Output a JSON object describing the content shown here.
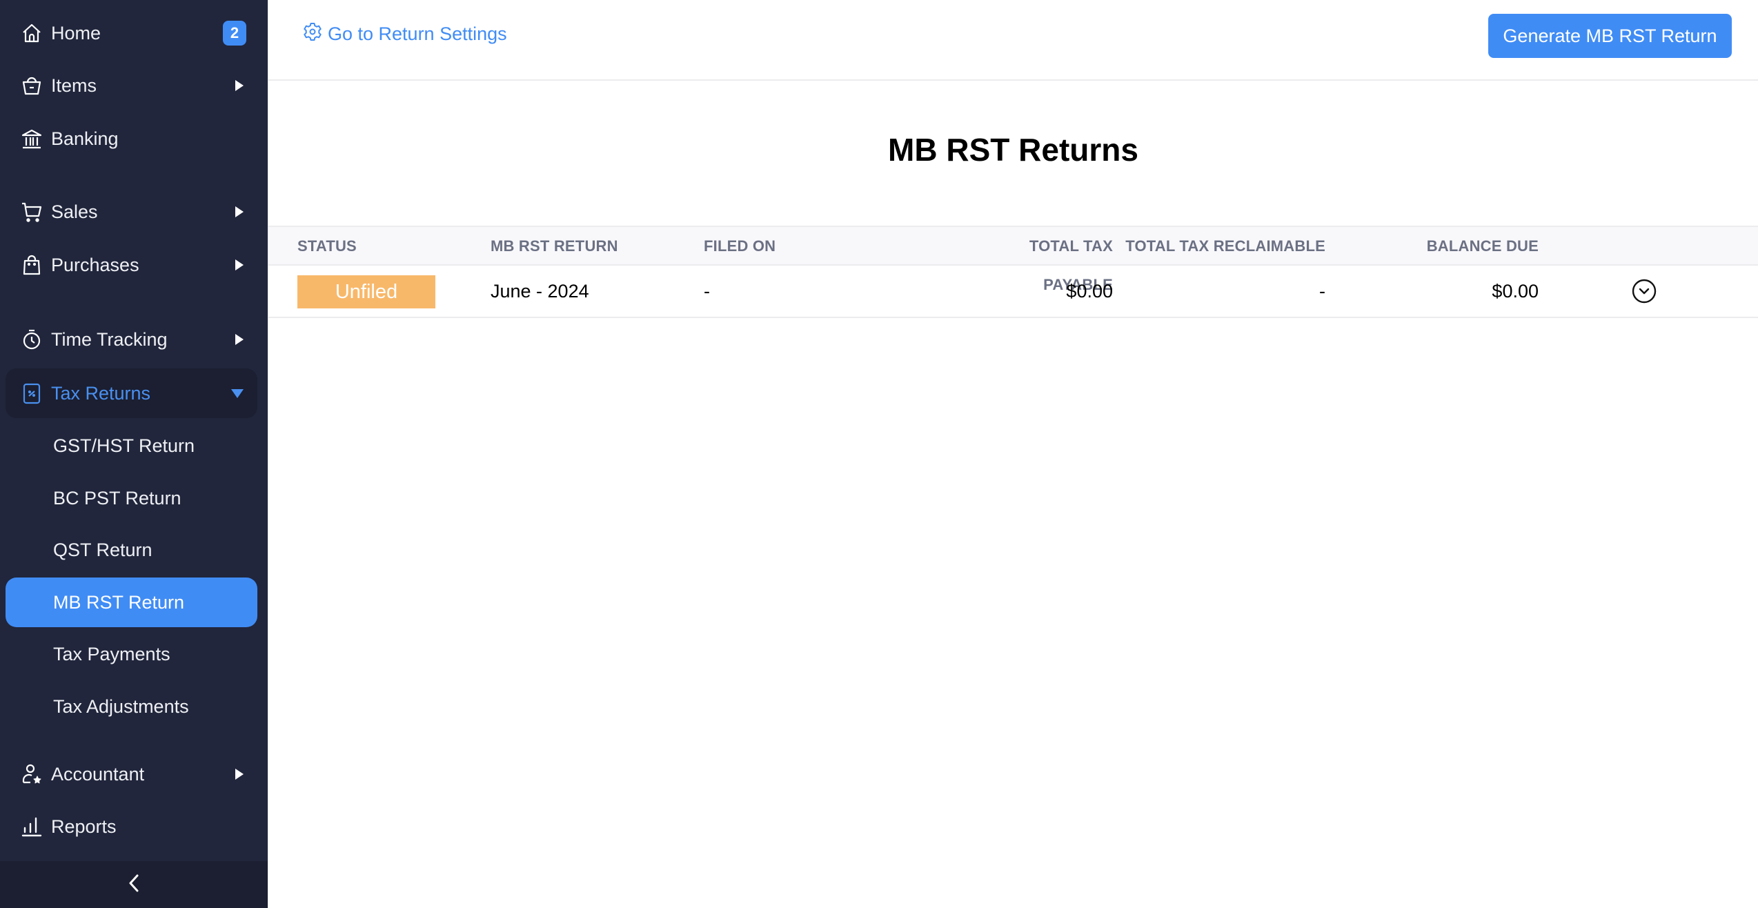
{
  "sidebar": {
    "items": [
      {
        "label": "Home",
        "icon": "home-icon",
        "badge": "2"
      },
      {
        "label": "Items",
        "icon": "basket-icon"
      },
      {
        "label": "Banking",
        "icon": "bank-icon"
      },
      {
        "label": "Sales",
        "icon": "cart-icon"
      },
      {
        "label": "Purchases",
        "icon": "shopping-bag-icon"
      },
      {
        "label": "Time Tracking",
        "icon": "stopwatch-icon"
      },
      {
        "label": "Tax Returns",
        "icon": "tax-percent-icon"
      },
      {
        "label": "Accountant",
        "icon": "accountant-icon"
      },
      {
        "label": "Reports",
        "icon": "bar-chart-icon"
      }
    ],
    "tax_sub_items": [
      {
        "label": "GST/HST Return"
      },
      {
        "label": "BC PST Return"
      },
      {
        "label": "QST Return"
      },
      {
        "label": "MB RST Return",
        "active": true
      },
      {
        "label": "Tax Payments"
      },
      {
        "label": "Tax Adjustments"
      }
    ],
    "collapse_icon": "chevron-left-icon"
  },
  "topbar": {
    "settings_link": "Go to Return Settings",
    "generate_button": "Generate MB RST Return"
  },
  "page": {
    "title": "MB RST Returns"
  },
  "table": {
    "headers": {
      "status": "STATUS",
      "return": "MB RST RETURN",
      "filed_on": "FILED ON",
      "total_tax_payable": "TOTAL TAX PAYABLE",
      "total_tax_reclaimable": "TOTAL TAX RECLAIMABLE",
      "balance_due": "BALANCE DUE"
    },
    "rows": [
      {
        "status": "Unfiled",
        "return": "June - 2024",
        "filed_on": "-",
        "total_tax_payable": "$0.00",
        "total_tax_reclaimable": "-",
        "balance_due": "$0.00"
      }
    ]
  },
  "colors": {
    "accent": "#408cf5",
    "sidebar_bg": "#21263c",
    "status_unfiled": "#f8b86a"
  }
}
